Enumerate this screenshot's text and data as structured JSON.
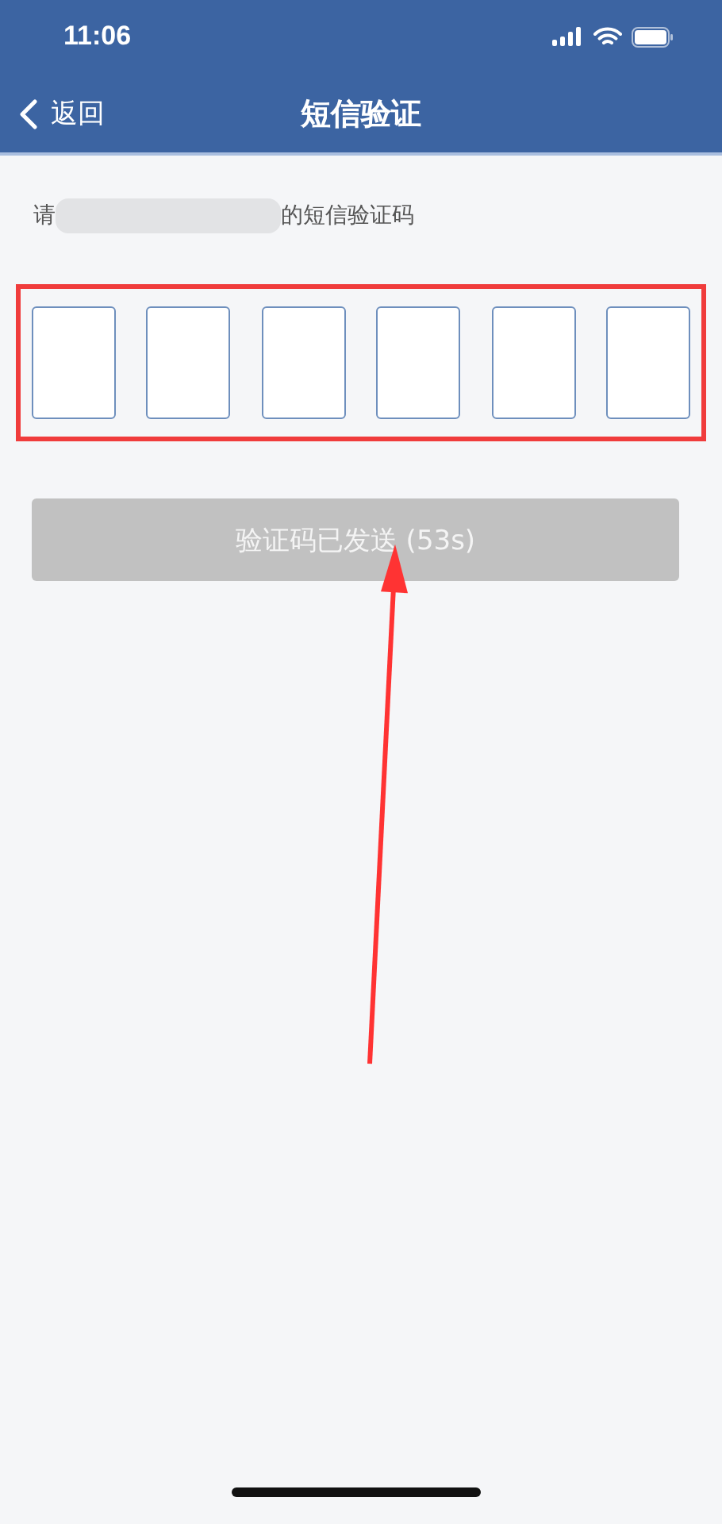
{
  "status_bar": {
    "time": "11:06"
  },
  "nav_bar": {
    "back_label": "返回",
    "title": "短信验证"
  },
  "hint": {
    "before": "请",
    "after": "的短信验证码"
  },
  "code_boxes": [
    {
      "kind": "digit"
    },
    {
      "kind": "digit"
    },
    {
      "kind": "digit"
    },
    {
      "kind": "digit"
    },
    {
      "kind": "digit"
    },
    {
      "kind": "digit"
    }
  ],
  "send_button": {
    "label": "验证码已发送 (53s)",
    "disabled": true
  }
}
